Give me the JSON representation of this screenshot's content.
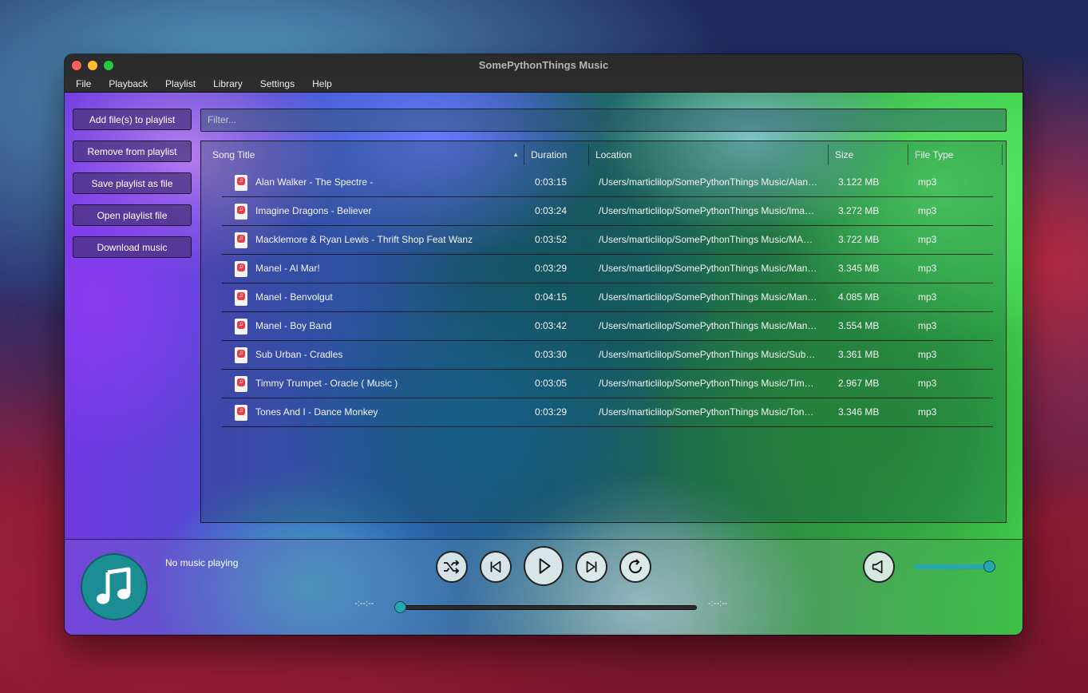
{
  "window": {
    "title": "SomePythonThings Music"
  },
  "menu": [
    "File",
    "Playback",
    "Playlist",
    "Library",
    "Settings",
    "Help"
  ],
  "sidebar": {
    "buttons": [
      "Add file(s) to playlist",
      "Remove from playlist",
      "Save playlist as file",
      "Open playlist file",
      "Download music"
    ]
  },
  "filter": {
    "placeholder": "Filter..."
  },
  "table": {
    "columns": [
      "Song Title",
      "Duration",
      "Location",
      "Size",
      "File Type"
    ],
    "sort_column": "Song Title",
    "rows": [
      {
        "title": "Alan Walker - The Spectre -",
        "duration": "0:03:15",
        "location": "/Users/marticlilop/SomePythonThings Music/Alan…",
        "size": "3.122 MB",
        "type": "mp3"
      },
      {
        "title": "Imagine Dragons - Believer",
        "duration": "0:03:24",
        "location": "/Users/marticlilop/SomePythonThings Music/Ima…",
        "size": "3.272 MB",
        "type": "mp3"
      },
      {
        "title": "Macklemore & Ryan Lewis - Thrift Shop Feat Wanz",
        "duration": "0:03:52",
        "location": "/Users/marticlilop/SomePythonThings Music/MA…",
        "size": "3.722 MB",
        "type": "mp3"
      },
      {
        "title": "Manel - Al Mar!",
        "duration": "0:03:29",
        "location": "/Users/marticlilop/SomePythonThings Music/Man…",
        "size": "3.345 MB",
        "type": "mp3"
      },
      {
        "title": "Manel - Benvolgut",
        "duration": "0:04:15",
        "location": "/Users/marticlilop/SomePythonThings Music/Man…",
        "size": "4.085 MB",
        "type": "mp3"
      },
      {
        "title": "Manel - Boy Band",
        "duration": "0:03:42",
        "location": "/Users/marticlilop/SomePythonThings Music/Man…",
        "size": "3.554 MB",
        "type": "mp3"
      },
      {
        "title": "Sub Urban - Cradles",
        "duration": "0:03:30",
        "location": "/Users/marticlilop/SomePythonThings Music/Sub…",
        "size": "3.361 MB",
        "type": "mp3"
      },
      {
        "title": "Timmy Trumpet - Oracle ( Music )",
        "duration": "0:03:05",
        "location": "/Users/marticlilop/SomePythonThings Music/Tim…",
        "size": "2.967 MB",
        "type": "mp3"
      },
      {
        "title": "Tones And I - Dance Monkey",
        "duration": "0:03:29",
        "location": "/Users/marticlilop/SomePythonThings Music/Ton…",
        "size": "3.346 MB",
        "type": "mp3"
      }
    ]
  },
  "player": {
    "status": "No music playing",
    "elapsed": "-:--:--",
    "remaining": "-:--:--",
    "progress": 0,
    "volume": 1.0,
    "accent_color": "#27a6b0",
    "controls": [
      "shuffle-icon",
      "previous-icon",
      "play-icon",
      "next-icon",
      "repeat-icon",
      "volume-icon"
    ]
  }
}
